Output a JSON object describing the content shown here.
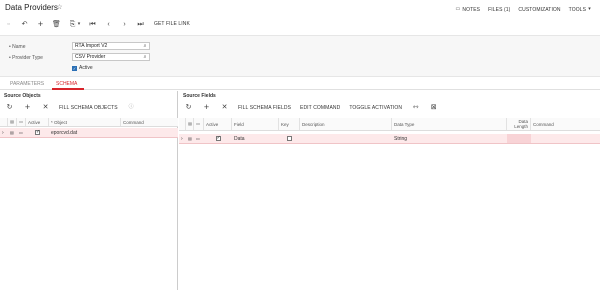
{
  "header": {
    "title": "Data Providers",
    "links": [
      "NOTES",
      "FILES (1)",
      "CUSTOMIZATION",
      "TOOLS"
    ],
    "toolbar_action": "GET FILE LINK"
  },
  "form": {
    "name_label": "Name",
    "name_value": "RTA Import V2",
    "provider_label": "Provider Type",
    "provider_value": "CSV Provider",
    "active_label": "Active",
    "active_checked": true
  },
  "tabs": [
    {
      "label": "PARAMETERS",
      "active": false
    },
    {
      "label": "SCHEMA",
      "active": true
    }
  ],
  "left_panel": {
    "title": "Source Objects",
    "fill_label": "FILL SCHEMA OBJECTS",
    "columns": [
      "Active",
      "* Object",
      "Command"
    ],
    "rows": [
      {
        "active": true,
        "object": "eporcvd.dat",
        "command": ""
      }
    ]
  },
  "right_panel": {
    "title": "Source Fields",
    "actions": [
      "FILL SCHEMA FIELDS",
      "EDIT COMMAND",
      "TOGGLE ACTIVATION"
    ],
    "columns": [
      "Active",
      "Field",
      "Key",
      "Description",
      "Data Type",
      "Data Length",
      "Command"
    ],
    "rows": [
      {
        "active": true,
        "field": "Data",
        "key": false,
        "description": "",
        "data_type": "String",
        "data_length": "",
        "command": ""
      }
    ]
  },
  "colors": {
    "accent": "#d8232a",
    "selected_row": "#fde9ea",
    "link": "#2a6fb5"
  }
}
